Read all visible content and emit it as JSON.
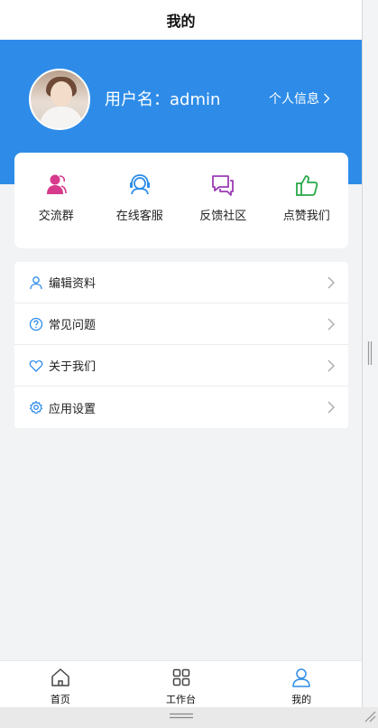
{
  "header": {
    "title": "我的"
  },
  "profile": {
    "username": "用户名：admin",
    "info_link": "个人信息"
  },
  "quick_actions": [
    {
      "label": "交流群",
      "icon": "user-group-icon",
      "color": "#d63a8c"
    },
    {
      "label": "在线客服",
      "icon": "headset-icon",
      "color": "#2e8ce8"
    },
    {
      "label": "反馈社区",
      "icon": "chat-bubbles-icon",
      "color": "#9b3bb5"
    },
    {
      "label": "点赞我们",
      "icon": "thumbs-up-icon",
      "color": "#2aa84a"
    }
  ],
  "menu": [
    {
      "label": "编辑资料",
      "icon": "user-icon"
    },
    {
      "label": "常见问题",
      "icon": "question-icon"
    },
    {
      "label": "关于我们",
      "icon": "heart-icon"
    },
    {
      "label": "应用设置",
      "icon": "gear-icon"
    }
  ],
  "tabbar": [
    {
      "label": "首页",
      "icon": "home-icon"
    },
    {
      "label": "工作台",
      "icon": "grid-icon"
    },
    {
      "label": "我的",
      "icon": "person-icon"
    }
  ],
  "colors": {
    "primary": "#2e8ce8",
    "background": "#f2f3f5",
    "menu_icon": "#2e8ce8"
  }
}
